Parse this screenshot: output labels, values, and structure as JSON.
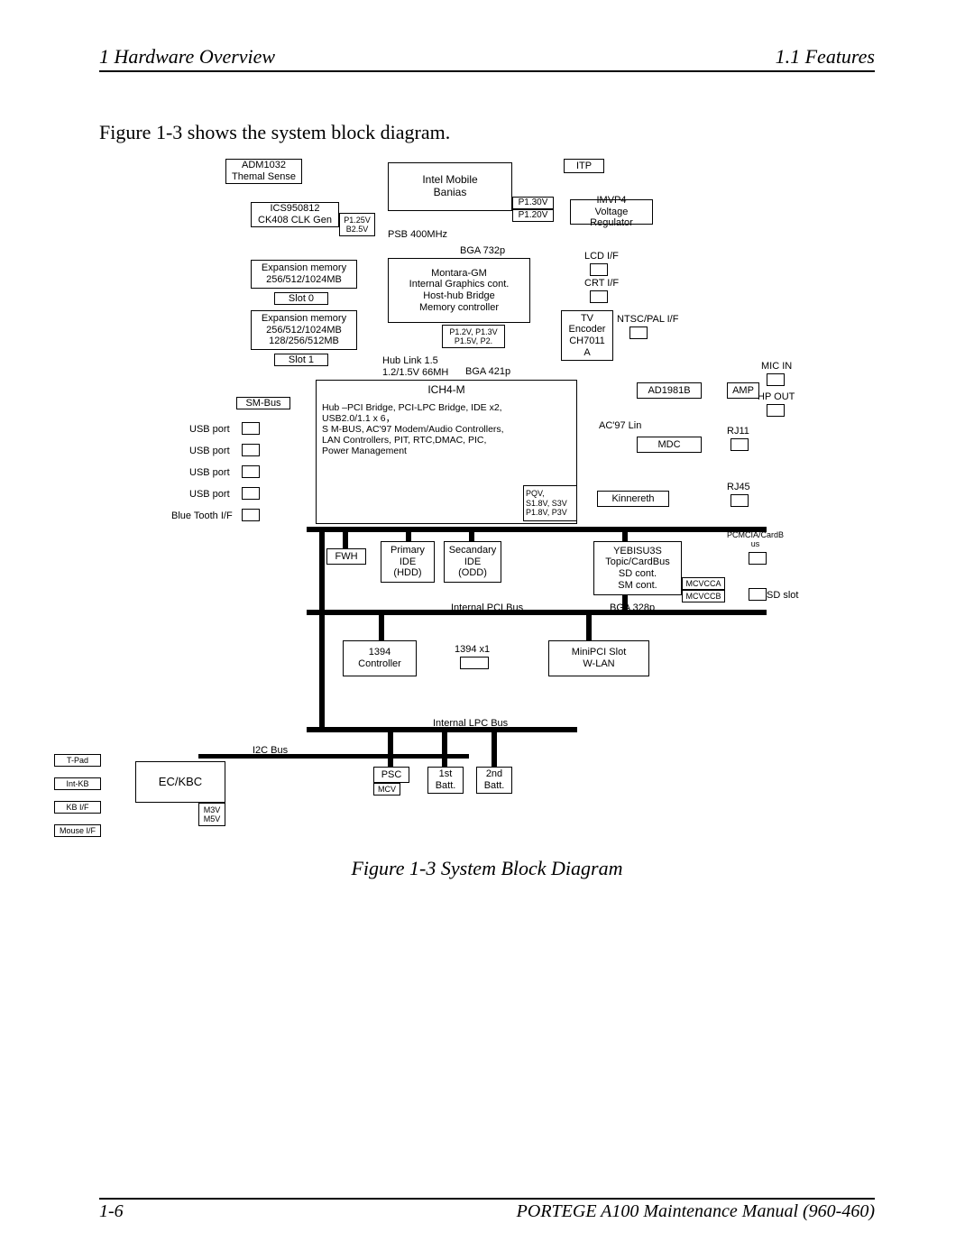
{
  "header": {
    "left": "1  Hardware Overview",
    "right": "1.1  Features"
  },
  "intro": "Figure 1-3 shows the system block diagram.",
  "caption": "Figure 1-3  System Block Diagram",
  "footer": {
    "left": "1-6",
    "right": "PORTEGE A100 Maintenance Manual (960-460)"
  },
  "blk": {
    "adm1032": "ADM1032\nThemal Sense",
    "itp": "ITP",
    "cpu": "Intel  Mobile\nBanias",
    "ics": "ICS950812\nCK408 CLK Gen",
    "ics_v": "P1.25V\nB2.5V",
    "imvp": "IMVP4\nVoltage Regulator",
    "psb": "PSB  400MHz",
    "bga732": "BGA  732p",
    "gmch": "Montara-GM\nInternal Graphics cont.\nHost-hub Bridge\nMemory controller",
    "gmch_v": "P1.2V, P1.3V\nP1.5V, P2.",
    "exp0": "Expansion  memory\n256/512/1024MB",
    "slot0": "Slot  0",
    "exp1": "Expansion  memory\n256/512/1024MB\n128/256/512MB",
    "slot1": "Slot  1",
    "lcd": "LCD  I/F",
    "crt": "CRT  I/F",
    "tv": "TV\nEncoder\nCH7011\nA",
    "ntsc": "NTSC/PAL   I/F",
    "hub": "Hub Link 1.5\n1.2/1.5V 66MH",
    "bga421": "BGA  421p",
    "ich": "ICH4-M",
    "ich_det": "Hub –PCI Bridge, PCI-LPC Bridge, IDE x2,\nUSB2.0/1.1 x 6，\nS M-BUS, AC'97 Modem/Audio Controllers,\nLAN Controllers, PIT, RTC,DMAC, PIC,\nPower Management",
    "ich_v": "PQV,\nS1.8V, S3V\nP1.8V, P3V",
    "smbus": "SM-Bus",
    "usb": "USB  port",
    "bt": "Blue Tooth I/F",
    "ad1981": "AD1981B",
    "amp": "AMP",
    "mic": "MIC  IN",
    "hp": "HP  OUT",
    "ac97": "AC'97  Lin",
    "mdc": "MDC",
    "rj11": "RJ11",
    "kin": "Kinnereth",
    "rj45": "RJ45",
    "fwh": "FWH",
    "pide": "Primary\nIDE\n(HDD)",
    "side": "Secandary\nIDE\n(ODD)",
    "yeb": "YEBISU3S\nTopic/CardBus\nSD cont.\nSM  cont.",
    "pcmcia": "PCMCIA/CardB\nus",
    "mcvcca": "MCVCCA",
    "mcvccb": "MCVCCB",
    "sdslot": "SD  slot",
    "bga328": "BGA  328p",
    "pcibus": "Internal  PCI  Bus",
    "c1394": "1394\nController",
    "x1394": "1394  x1",
    "mini": "MiniPCI  Slot\nW-LAN",
    "lpcbus": "Internal  LPC  Bus",
    "i2c": "I2C  Bus",
    "eckbc": "EC/KBC",
    "ec_v": "M3V\nM5V",
    "tpad": "T-Pad",
    "intkb": "Int-KB",
    "kbif": "KB  I/F",
    "mouse": "Mouse  I/F",
    "psc": "PSC",
    "psc_v": "MCV",
    "bat1": "1st\nBatt.",
    "bat2": "2nd\nBatt.",
    "p130": "P1.30V",
    "p120": "P1.20V"
  }
}
